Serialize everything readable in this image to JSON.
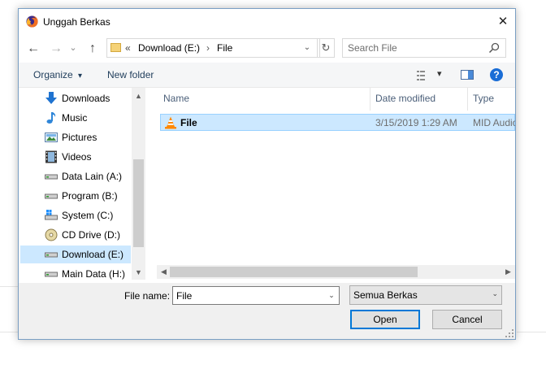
{
  "window": {
    "title": "Unggah Berkas",
    "close_glyph": "✕",
    "app_icon": "firefox-icon"
  },
  "nav": {
    "back_glyph": "←",
    "forward_glyph": "→",
    "recent_glyph": "⌄",
    "up_glyph": "↑",
    "breadcrumb_prefix": "«",
    "breadcrumbs": [
      "Download (E:)",
      "File"
    ],
    "breadcrumb_separator": "›",
    "address_dropdown_glyph": "⌄",
    "refresh_glyph": "↻",
    "search_placeholder": "Search File"
  },
  "toolbar": {
    "organize_label": "Organize",
    "organize_caret": "▾",
    "new_folder_label": "New folder",
    "view_caret": "▾",
    "help_glyph": "?"
  },
  "sidebar": {
    "items": [
      {
        "label": "Downloads",
        "icon": "download-arrow-icon"
      },
      {
        "label": "Music",
        "icon": "music-note-icon"
      },
      {
        "label": "Pictures",
        "icon": "pictures-icon"
      },
      {
        "label": "Videos",
        "icon": "film-icon"
      },
      {
        "label": "Data Lain (A:)",
        "icon": "drive-icon"
      },
      {
        "label": "Program (B:)",
        "icon": "drive-icon"
      },
      {
        "label": "System (C:)",
        "icon": "windows-drive-icon"
      },
      {
        "label": "CD Drive (D:)",
        "icon": "cd-drive-icon"
      },
      {
        "label": "Download (E:)",
        "icon": "drive-icon",
        "selected": true
      },
      {
        "label": "Main Data (H:)",
        "icon": "drive-icon"
      }
    ],
    "scroll_up_glyph": "▲",
    "scroll_down_glyph": "▼"
  },
  "file_list": {
    "columns": [
      "Name",
      "Date modified",
      "Type"
    ],
    "sort_glyph": "⌃",
    "files": [
      {
        "name": "File",
        "date": "3/15/2019 1:29 AM",
        "type": "MID Audio",
        "icon": "vlc-cone-icon",
        "selected": true
      }
    ],
    "scroll_left_glyph": "◀",
    "scroll_right_glyph": "▶"
  },
  "footer": {
    "file_name_label": "File name:",
    "file_name_value": "File",
    "file_name_dropdown_glyph": "⌄",
    "file_type_value": "Semua Berkas",
    "file_type_dropdown_glyph": "⌄",
    "open_label": "Open",
    "cancel_label": "Cancel"
  },
  "colors": {
    "selection": "#cce8ff",
    "accent": "#0078d7",
    "help": "#1a6dd6"
  }
}
